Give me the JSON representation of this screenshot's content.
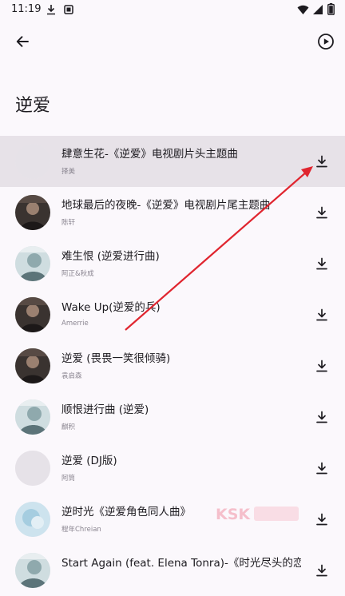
{
  "status_bar": {
    "time": "11:19",
    "icons": [
      "download-icon",
      "notification-icon",
      "wifi-icon",
      "signal-icon",
      "battery-icon"
    ]
  },
  "top_bar": {
    "back_icon": "arrow-left-icon",
    "play_icon": "play-circle-icon"
  },
  "page": {
    "title": "逆爱"
  },
  "songs": [
    {
      "title": "肆意生花-《逆爱》电视剧片头主题曲",
      "artist": "择美",
      "selected": true,
      "avatar": "blank"
    },
    {
      "title": "地球最后的夜晚-《逆爱》电视剧片尾主题曲",
      "artist": "陈轩",
      "selected": false,
      "avatar": "photo-dark"
    },
    {
      "title": "难生恨 (逆爱进行曲)",
      "artist": "阿正&秋成",
      "selected": false,
      "avatar": "photo-light"
    },
    {
      "title": "Wake Up(逆爱的兵)",
      "artist": "Amerrie",
      "selected": false,
      "avatar": "photo-dark"
    },
    {
      "title": "逆爱 (畏畏一笑很倾骑)",
      "artist": "袁启森",
      "selected": false,
      "avatar": "photo-dark"
    },
    {
      "title": "顺恨进行曲 (逆爱)",
      "artist": "麒积",
      "selected": false,
      "avatar": "photo-light"
    },
    {
      "title": "逆爱 (DJ版)",
      "artist": "阿筒",
      "selected": false,
      "avatar": "blank"
    },
    {
      "title": "逆时光《逆爱角色同人曲》",
      "artist": "程年Chreian",
      "selected": false,
      "avatar": "photo-blue"
    },
    {
      "title": "Start Again (feat. Elena Tonra)-《时光尽头的恋…",
      "artist": "",
      "selected": false,
      "avatar": "photo-light"
    }
  ],
  "watermark": {
    "text": "KSK"
  },
  "colors": {
    "background": "#fbf8fc",
    "selected_row": "#e7e2e8",
    "annotation_arrow": "#e0252f"
  }
}
